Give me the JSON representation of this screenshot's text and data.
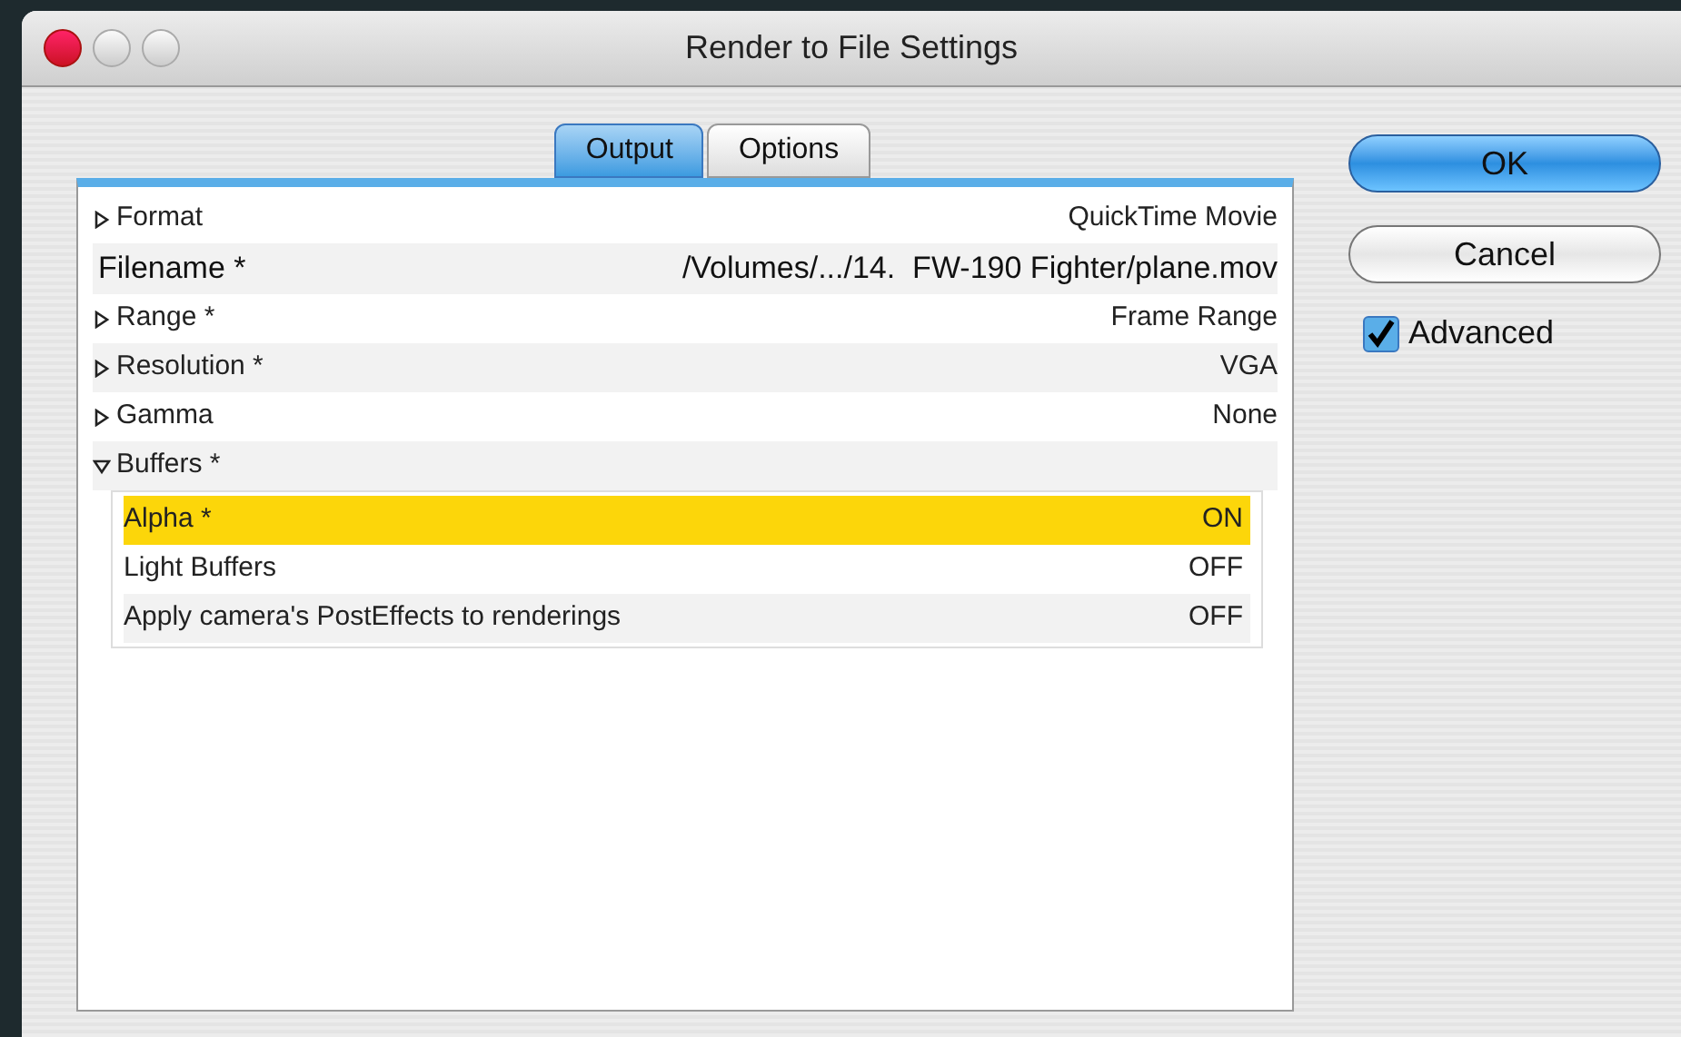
{
  "window": {
    "title": "Render to File Settings"
  },
  "tabs": [
    {
      "label": "Output",
      "selected": true
    },
    {
      "label": "Options",
      "selected": false
    }
  ],
  "settings": [
    {
      "kind": "group",
      "label": "Format",
      "value": "QuickTime Movie",
      "expanded": false
    },
    {
      "kind": "field",
      "label": "Filename *",
      "value": "/Volumes/.../14.  FW-190 Fighter/plane.mov"
    },
    {
      "kind": "group",
      "label": "Range *",
      "value": "Frame Range",
      "expanded": false
    },
    {
      "kind": "group",
      "label": "Resolution *",
      "value": "VGA",
      "expanded": false
    },
    {
      "kind": "group",
      "label": "Gamma",
      "value": "None",
      "expanded": false
    },
    {
      "kind": "group",
      "label": "Buffers *",
      "expanded": true,
      "children": [
        {
          "label": "Alpha *",
          "value": "ON",
          "selected": true
        },
        {
          "label": "Light Buffers",
          "value": "OFF",
          "selected": false
        },
        {
          "label": "Apply camera's PostEffects to renderings",
          "value": "OFF",
          "selected": false
        }
      ]
    }
  ],
  "buttons": [
    {
      "label": "OK",
      "kind": "default"
    },
    {
      "label": "Cancel",
      "kind": "normal"
    }
  ],
  "advanced": {
    "label": "Advanced",
    "checked": true
  }
}
